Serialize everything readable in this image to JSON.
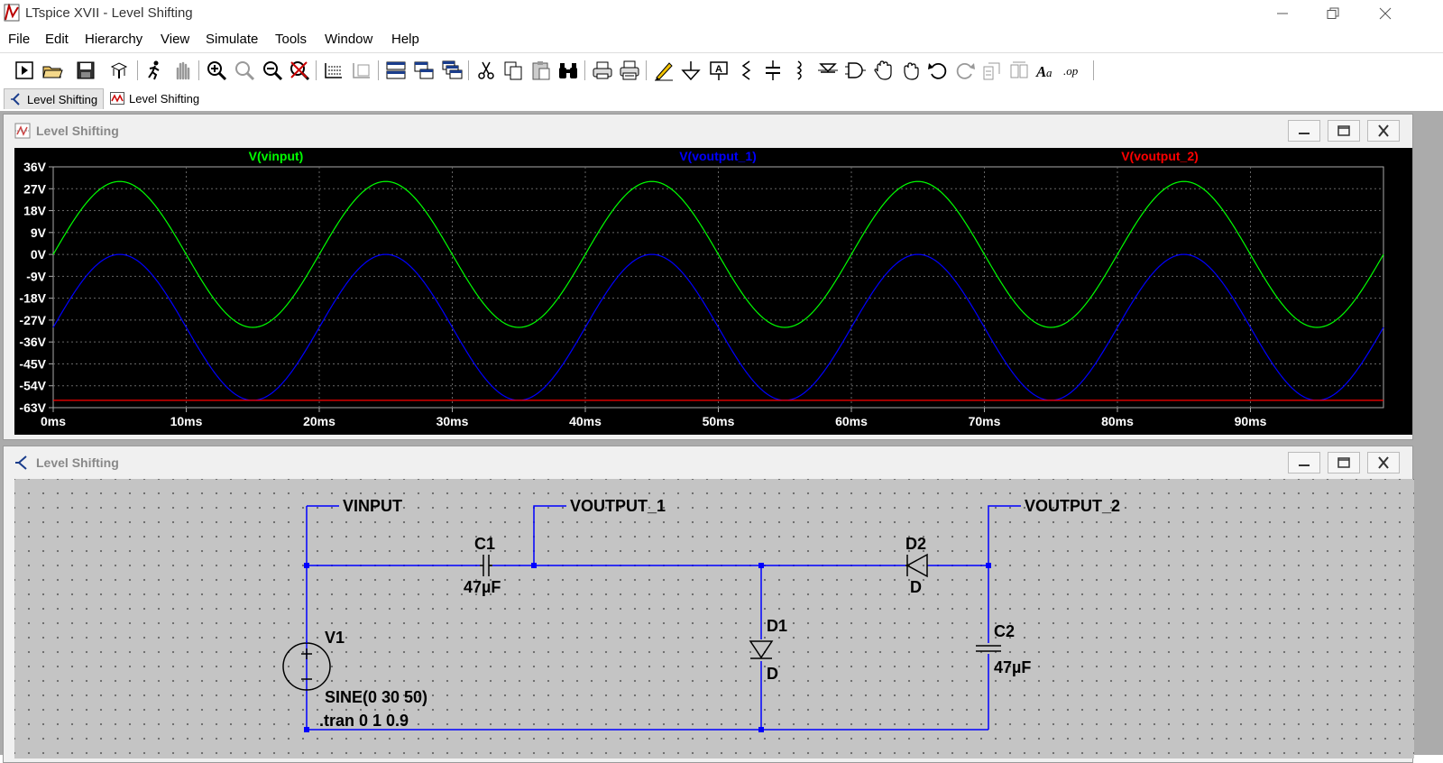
{
  "window": {
    "title": "LTspice XVII - Level Shifting",
    "controls": [
      "minimize",
      "restore",
      "close"
    ]
  },
  "menu": [
    "File",
    "Edit",
    "Hierarchy",
    "View",
    "Simulate",
    "Tools",
    "Window",
    "Help"
  ],
  "toolbar_icons": [
    "new-schematic-icon",
    "open-icon",
    "save-icon",
    "control-panel-icon",
    "run-icon",
    "halt-icon",
    "zoom-in-icon",
    "zoom-to-fit-icon",
    "zoom-out-icon",
    "cancel-zoom-icon",
    "autorange-icon",
    "delete-trace-icon",
    "tile-vertical-icon",
    "tile-horizontal-icon",
    "cascade-icon",
    "cut-icon",
    "copy-icon",
    "paste-icon",
    "find-icon",
    "print-icon",
    "print-setup-icon",
    "draw-wire-icon",
    "ground-icon",
    "label-net-icon",
    "resistor-icon",
    "capacitor-icon",
    "inductor-icon",
    "diode-icon",
    "component-icon",
    "move-icon",
    "drag-icon",
    "undo-icon",
    "redo-icon",
    "rotate-icon",
    "mirror-icon",
    "text-icon",
    "spice-directive-icon"
  ],
  "tabs": [
    {
      "label": "Level Shifting",
      "icon": "schematic-icon",
      "active": true
    },
    {
      "label": "Level Shifting",
      "icon": "waveform-icon",
      "active": false
    }
  ],
  "plot_window": {
    "title": "Level Shifting"
  },
  "schematic_window": {
    "title": "Level Shifting"
  },
  "chart_data": {
    "type": "line",
    "series": [
      {
        "name": "V(vinput)",
        "color": "#00ff00",
        "function": "sine",
        "offset": 0,
        "amplitude": 30,
        "frequency_hz": 50
      },
      {
        "name": "V(voutput_1)",
        "color": "#0000ff",
        "function": "sine",
        "offset": -30,
        "amplitude": 30,
        "frequency_hz": 50
      },
      {
        "name": "V(voutput_2)",
        "color": "#ff0000",
        "function": "constant",
        "value": -60
      }
    ],
    "x_range_ms": [
      0,
      100
    ],
    "ylim": [
      -63,
      36
    ],
    "y_ticks": [
      "36V",
      "27V",
      "18V",
      "9V",
      "0V",
      "-9V",
      "-18V",
      "-27V",
      "-36V",
      "-45V",
      "-54V",
      "-63V"
    ],
    "x_ticks": [
      "0ms",
      "10ms",
      "20ms",
      "30ms",
      "40ms",
      "50ms",
      "60ms",
      "70ms",
      "80ms",
      "90ms"
    ],
    "grid": true,
    "background": "#000000",
    "tick_color": "#ffffff"
  },
  "schematic": {
    "net_labels": {
      "vinput": "VINPUT",
      "voutput1": "VOUTPUT_1",
      "voutput2": "VOUTPUT_2"
    },
    "c1": {
      "name": "C1",
      "value": "47µF"
    },
    "c2": {
      "name": "C2",
      "value": "47µF"
    },
    "d1": {
      "name": "D1",
      "model": "D"
    },
    "d2": {
      "name": "D2",
      "model": "D"
    },
    "v1": {
      "name": "V1",
      "value": "SINE(0 30 50)"
    },
    "directive": ".tran 0 1 0.9",
    "wire_color": "#0000ff"
  }
}
